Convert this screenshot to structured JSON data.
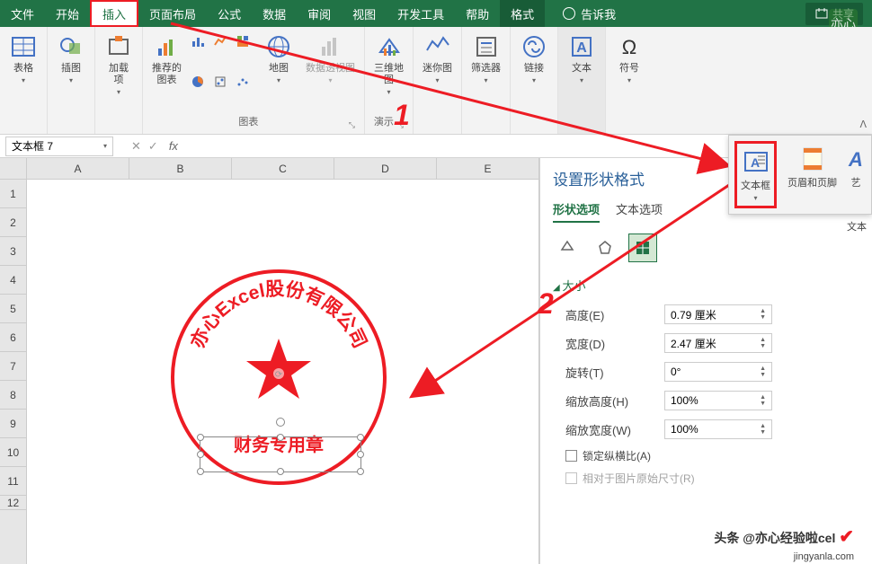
{
  "menu": {
    "file": "文件",
    "home": "开始",
    "insert": "插入",
    "layout": "页面布局",
    "formula": "公式",
    "data": "数据",
    "review": "审阅",
    "view": "视图",
    "dev": "开发工具",
    "help": "帮助",
    "format": "格式",
    "tellme": "告诉我",
    "share": "共享"
  },
  "ribbon": {
    "table": "表格",
    "illustration": "插图",
    "addin": "加载\n项",
    "recommended_chart": "推荐的\n图表",
    "charts_group": "图表",
    "map": "地图",
    "pivot_chart": "数据透视图",
    "map3d": "三维地\n图",
    "demo_group": "演示",
    "sparkline": "迷你图",
    "filter": "筛选器",
    "link": "链接",
    "text": "文本",
    "symbol": "符号"
  },
  "text_dropdown": {
    "textbox": "文本框",
    "header_footer": "页眉和页脚",
    "wordart": "艺",
    "group_label": "文本"
  },
  "namebox": "文本框 7",
  "columns": [
    "A",
    "B",
    "C",
    "D",
    "E"
  ],
  "rows": [
    "1",
    "2",
    "3",
    "4",
    "5",
    "6",
    "7",
    "8",
    "9",
    "10",
    "11",
    "12"
  ],
  "stamp": {
    "company": "亦心Excel股份有限公司",
    "bottom": "财务专用章"
  },
  "panel": {
    "title": "设置形状格式",
    "tab_shape": "形状选项",
    "tab_text": "文本选项",
    "section_size": "大小",
    "height_label": "高度(E)",
    "height_val": "0.79 厘米",
    "width_label": "宽度(D)",
    "width_val": "2.47 厘米",
    "rotation_label": "旋转(T)",
    "rotation_val": "0°",
    "scale_h_label": "缩放高度(H)",
    "scale_h_val": "100%",
    "scale_w_label": "缩放宽度(W)",
    "scale_w_val": "100%",
    "lock_aspect": "锁定纵横比(A)",
    "relative_original": "相对于图片原始尺寸(R)"
  },
  "annotations": {
    "one": "1",
    "two": "2"
  },
  "watermark": {
    "main": "头条 @亦心经验啦cel",
    "sub": "jingyanla.com"
  }
}
